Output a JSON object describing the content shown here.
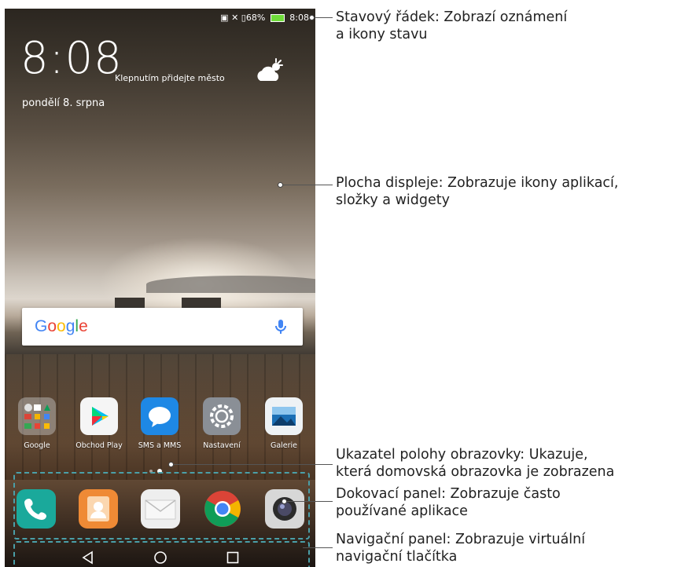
{
  "status_bar": {
    "battery_percent": "68%",
    "time": "8:08"
  },
  "lock_widget": {
    "clock": "8:08",
    "city_hint": "Klepnutím přidejte město",
    "date": "pondělí 8. srpna"
  },
  "search": {
    "logo": "Google"
  },
  "apps": [
    {
      "label": "Google",
      "icon": "google-folder-icon"
    },
    {
      "label": "Obchod Play",
      "icon": "play-store-icon"
    },
    {
      "label": "SMS a MMS",
      "icon": "messages-icon"
    },
    {
      "label": "Nastavení",
      "icon": "settings-icon"
    },
    {
      "label": "Galerie",
      "icon": "gallery-icon"
    }
  ],
  "dock": [
    "phone-icon",
    "contacts-icon",
    "email-icon",
    "chrome-icon",
    "camera-icon"
  ],
  "navigation": [
    "back-icon",
    "home-icon",
    "recents-icon"
  ],
  "annotations": {
    "status_bar": [
      "Stavový řádek: Zobrazí oznámení",
      "a ikony stavu"
    ],
    "home_screen": [
      "Plocha displeje: Zobrazuje ikony aplikací,",
      "složky a widgety"
    ],
    "page_indicator": [
      "Ukazatel polohy obrazovky: Ukazuje,",
      "která domovská obrazovka je zobrazena"
    ],
    "dock": [
      "Dokovací panel: Zobrazuje často",
      "používané aplikace"
    ],
    "nav_bar": [
      "Navigační panel: Zobrazuje virtuální",
      "navigační tlačítka"
    ]
  },
  "colors": {
    "accent_dash": "#4a9fa8",
    "battery": "#6fdc3a"
  }
}
